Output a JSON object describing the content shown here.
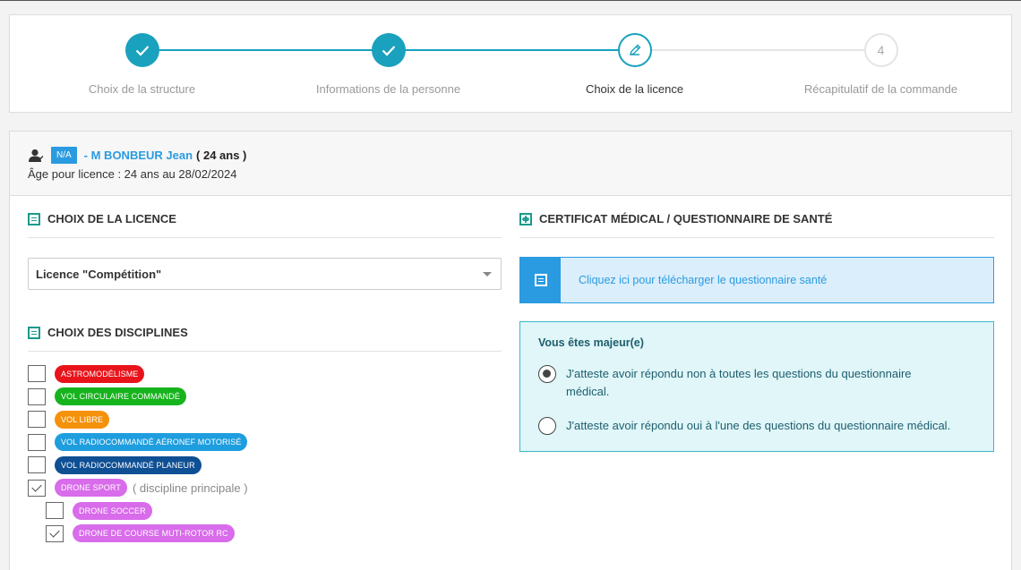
{
  "stepper": {
    "steps": [
      {
        "label": "Choix de la structure",
        "state": "done"
      },
      {
        "label": "Informations de la personne",
        "state": "done"
      },
      {
        "label": "Choix de la licence",
        "state": "current"
      },
      {
        "label": "Récapitulatif de la commande",
        "state": "todo",
        "number": "4"
      }
    ],
    "accent_color": "#19a1bd"
  },
  "person": {
    "badge": "N/A",
    "name": "- M BONBEUR Jean",
    "age": "( 24 ans )",
    "age_licence": "Âge pour licence : 24 ans au 28/02/2024"
  },
  "licence": {
    "section_title": "CHOIX DE LA LICENCE",
    "selected": "Licence \"Compétition\""
  },
  "disciplines": {
    "section_title": "CHOIX DES DISCIPLINES",
    "principal_label": "( discipline principale )",
    "items": [
      {
        "label": "ASTROMODÉLISME",
        "color": "#e8141b",
        "checked": false,
        "sub": false
      },
      {
        "label": "VOL CIRCULAIRE COMMANDÉ",
        "color": "#17b31d",
        "checked": false,
        "sub": false
      },
      {
        "label": "VOL LIBRE",
        "color": "#f5920b",
        "checked": false,
        "sub": false
      },
      {
        "label": "VOL RADIOCOMMANDÉ AÉRONEF MOTORISÉ",
        "color": "#1e9ddf",
        "checked": false,
        "sub": false
      },
      {
        "label": "VOL RADIOCOMMANDÉ PLANEUR",
        "color": "#0f4f94",
        "checked": false,
        "sub": false
      },
      {
        "label": "DRONE SPORT",
        "color": "#d86cea",
        "checked": true,
        "sub": false,
        "principal": true
      },
      {
        "label": "DRONE SOCCER",
        "color": "#d86cea",
        "checked": false,
        "sub": true
      },
      {
        "label": "DRONE DE COURSE MUTI-ROTOR RC",
        "color": "#d86cea",
        "checked": true,
        "sub": true
      }
    ]
  },
  "medical": {
    "section_title": "CERTIFICAT MÉDICAL / QUESTIONNAIRE DE SANTÉ",
    "download_text": "Cliquez ici pour télécharger le questionnaire santé",
    "major_title": "Vous êtes majeur(e)",
    "options": [
      {
        "text": "J'atteste avoir répondu non à toutes les questions du questionnaire médical.",
        "selected": true
      },
      {
        "text": "J'atteste avoir répondu oui à l'une des questions du questionnaire médical.",
        "selected": false
      }
    ]
  }
}
